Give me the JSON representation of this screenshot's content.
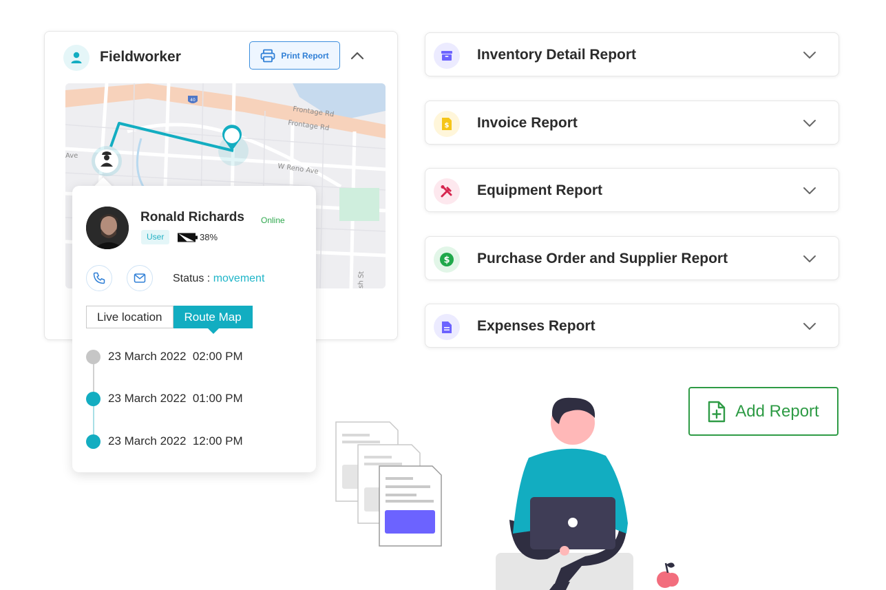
{
  "fieldworker": {
    "title": "Fieldworker",
    "print_label": "Print Report",
    "map": {
      "street_labels": [
        "Frontage Rd",
        "Frontage Rd",
        "W Reno Ave",
        "Ave",
        "sh St"
      ],
      "highway_shield": "40"
    },
    "user": {
      "name": "Ronald Richards",
      "presence": "Online",
      "role": "User",
      "battery": "38%",
      "status_label": "Status :",
      "status_value": "movement"
    },
    "tabs": [
      {
        "label": "Live location",
        "active": false
      },
      {
        "label": "Route Map",
        "active": true
      }
    ],
    "timeline": [
      {
        "text": "23 March 2022  02:00 PM",
        "state": "past"
      },
      {
        "text": "23 March 2022  01:00 PM",
        "state": "route"
      },
      {
        "text": "23 March 2022  12:00 PM",
        "state": "route"
      }
    ]
  },
  "reports": [
    {
      "title": "Inventory Detail Report",
      "icon": "archive-icon",
      "color": "#6c63ff",
      "bg": "#ecebff"
    },
    {
      "title": "Invoice Report",
      "icon": "invoice-icon",
      "color": "#f5c518",
      "bg": "#fff6da"
    },
    {
      "title": "Equipment Report",
      "icon": "tools-icon",
      "color": "#d6264f",
      "bg": "#fde8ee"
    },
    {
      "title": "Purchase Order and Supplier Report",
      "icon": "dollar-icon",
      "color": "#1fa84a",
      "bg": "#e2f6e8"
    },
    {
      "title": "Expenses Report",
      "icon": "document-icon",
      "color": "#6c63ff",
      "bg": "#ecebff"
    }
  ],
  "add_report_label": "Add Report",
  "colors": {
    "accent": "#12adc1",
    "green": "#2e9b45",
    "blue": "#2f7fd6"
  }
}
